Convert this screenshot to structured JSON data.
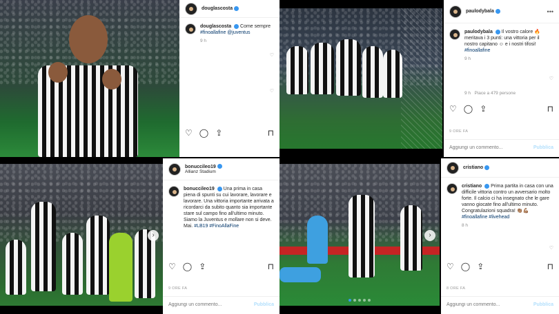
{
  "posts": [
    {
      "username": "douglascosta",
      "caption_user": "douglascosta",
      "caption": "Come sempre",
      "tags": "#finoallafine @juventus",
      "time": "9 h",
      "ago": "",
      "comment_placeholder": "",
      "publish": ""
    },
    {
      "username": "paulodybala",
      "caption_user": "paulodybala",
      "caption": "Il vostro calore 🔥 meritava i 3 punti: una vittoria per il nostro capitano ☺ e i nostri tifosi!",
      "tags": "#finoallafine",
      "time": "9 h",
      "reply_time": "9 h",
      "reply_likes": "Piace a 479 persone",
      "ago": "9 ORE FA",
      "comment_placeholder": "Aggiungi un commento...",
      "publish": "Pubblica"
    },
    {
      "username": "bonucci leo19",
      "display_username": "bonuccileo19",
      "location": "Allianz Stadium",
      "caption_user": "bonuccileo19",
      "caption": "Una prima in casa piena di spunti su cui lavorare, lavorare e lavorare. Una vittoria importante arrivata a ricordarci da subito quanto sia importante stare sul campo fino all'ultimo minuto. Siamo la Juventus e mollare non si deve. Mai.",
      "tags": "#LB19 #FinoAllaFine",
      "ago": "9 ORE FA",
      "comment_placeholder": "Aggiungi un commento...",
      "publish": "Pubblica"
    },
    {
      "username": "cristiano",
      "caption_user": "cristiano",
      "caption": "Prima partita in casa con una difficile vittoria contro un avversario molto forte. Il calcio ci ha insegnato che le gare vanno giocate fino all'ultimo minuto. Congratulazioni squadra! 👏🏽💪🏽",
      "tags": "#finoallafine #livehead",
      "time": "8 h",
      "ago": "8 ORE FA",
      "comment_placeholder": "Aggiungi un commento...",
      "publish": "Pubblica"
    }
  ],
  "icons": [
    "heart-icon",
    "comment-icon",
    "share-icon",
    "bookmark-icon",
    "more-icon",
    "verified-icon"
  ],
  "colors": {
    "link": "#003569",
    "accent": "#3897f0",
    "publish_disabled": "#b2dffc"
  }
}
